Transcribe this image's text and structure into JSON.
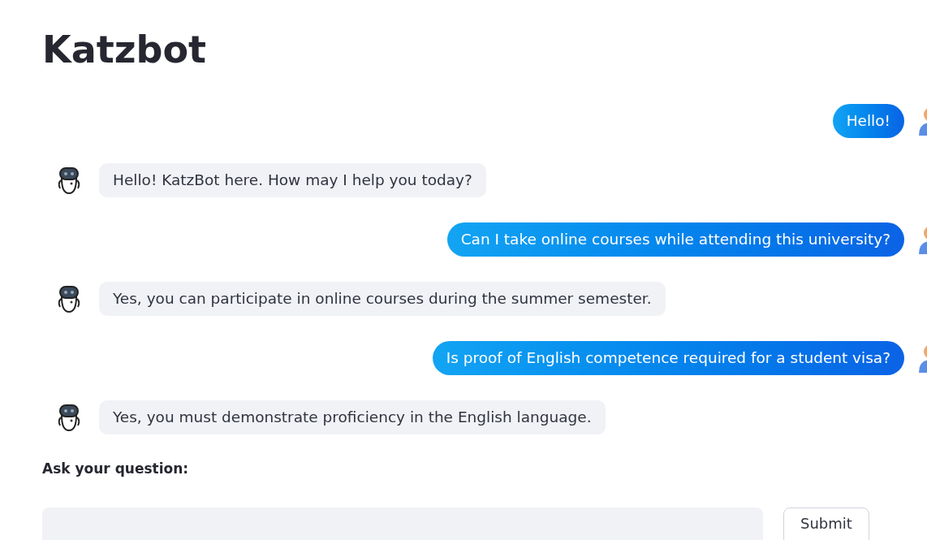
{
  "title": "Katzbot",
  "messages": [
    {
      "kind": "user",
      "text": "Hello!"
    },
    {
      "kind": "bot",
      "text": "Hello! KatzBot here. How may I help you today?"
    },
    {
      "kind": "user",
      "text": "Can I take online courses while attending this university?"
    },
    {
      "kind": "bot",
      "text": "Yes, you can participate in online courses during the summer semester."
    },
    {
      "kind": "user",
      "text": "Is proof of English competence required for a student visa?"
    },
    {
      "kind": "bot",
      "text": "Yes, you must demonstrate proficiency in the English language."
    }
  ],
  "question_label": "Ask your question:",
  "submit": "Submit"
}
